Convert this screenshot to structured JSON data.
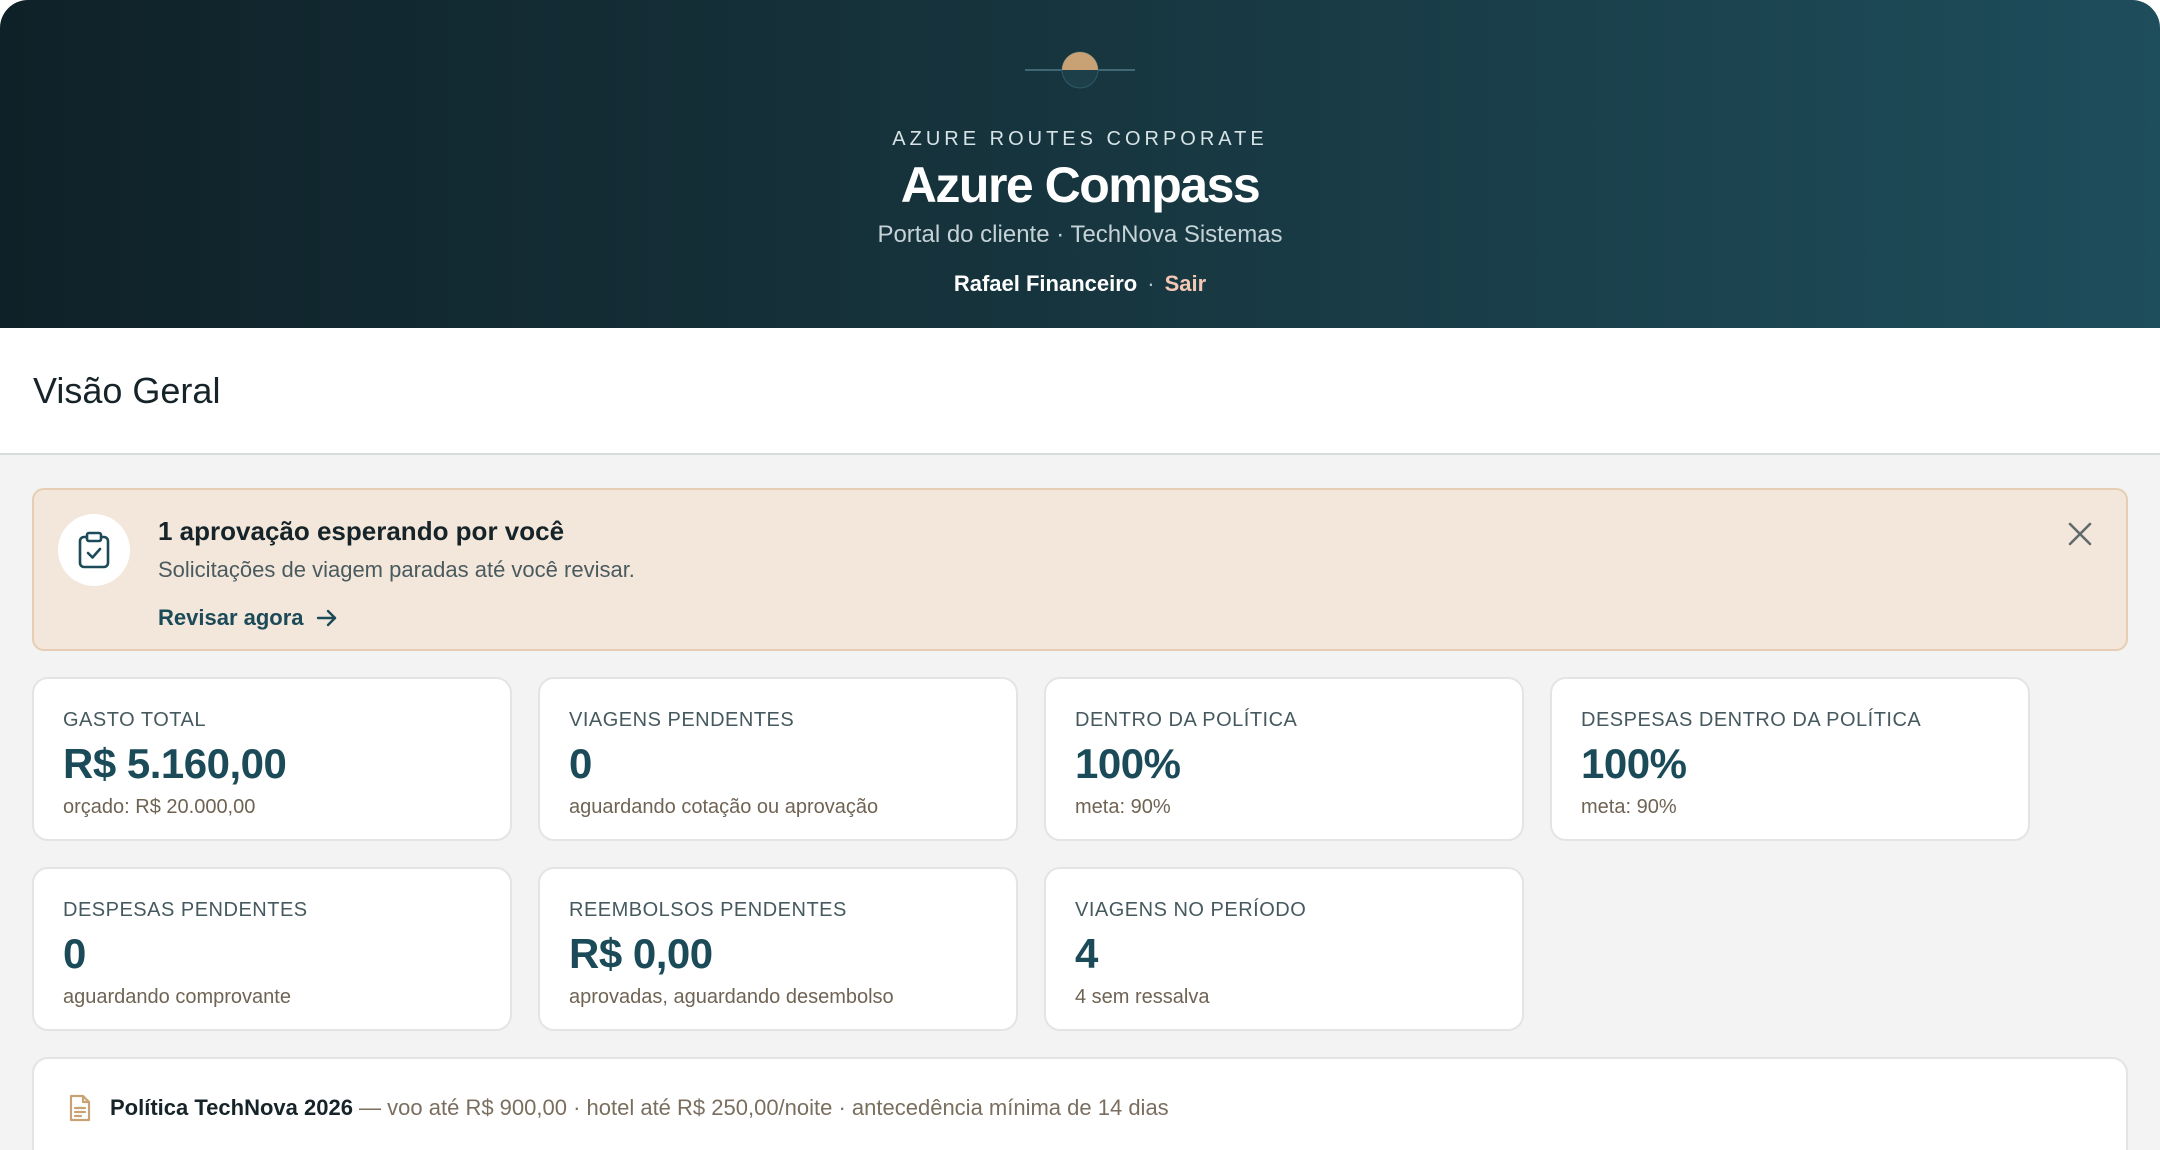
{
  "header": {
    "eyebrow": "AZURE ROUTES CORPORATE",
    "title": "Azure Compass",
    "subtitle": "Portal do cliente · TechNova Sistemas",
    "user_name": "Rafael Financeiro",
    "separator": "·",
    "logout_label": "Sair",
    "logo_icon": "sun-horizon-icon"
  },
  "page": {
    "title": "Visão Geral"
  },
  "alert": {
    "icon": "clipboard-check-icon",
    "title": "1 aprovação esperando por você",
    "description": "Solicitações de viagem paradas até você revisar.",
    "link_label": "Revisar agora",
    "link_icon": "arrow-right-icon",
    "close_icon": "close-icon"
  },
  "kpis": [
    {
      "label": "GASTO TOTAL",
      "value": "R$ 5.160,00",
      "sub": "orçado: R$ 20.000,00"
    },
    {
      "label": "VIAGENS PENDENTES",
      "value": "0",
      "sub": "aguardando cotação ou aprovação"
    },
    {
      "label": "DENTRO DA POLÍTICA",
      "value": "100%",
      "sub": "meta: 90%"
    },
    {
      "label": "DESPESAS DENTRO DA POLÍTICA",
      "value": "100%",
      "sub": "meta: 90%"
    },
    {
      "label": "DESPESAS PENDENTES",
      "value": "0",
      "sub": "aguardando comprovante"
    },
    {
      "label": "REEMBOLSOS PENDENTES",
      "value": "R$ 0,00",
      "sub": "aprovadas, aguardando desembolso"
    },
    {
      "label": "VIAGENS NO PERÍODO",
      "value": "4",
      "sub": "4 sem ressalva"
    }
  ],
  "policy": {
    "icon": "document-icon",
    "name": "Política TechNova 2026",
    "details": " — voo até R$ 900,00 · hotel até R$ 250,00/noite · antecedência mínima de 14 dias"
  },
  "colors": {
    "header_gradient_start": "#0f2128",
    "header_gradient_end": "#1e4d5b",
    "accent": "#1b4a58",
    "alert_bg": "#f2e7da",
    "logout": "#f3c7b3"
  }
}
